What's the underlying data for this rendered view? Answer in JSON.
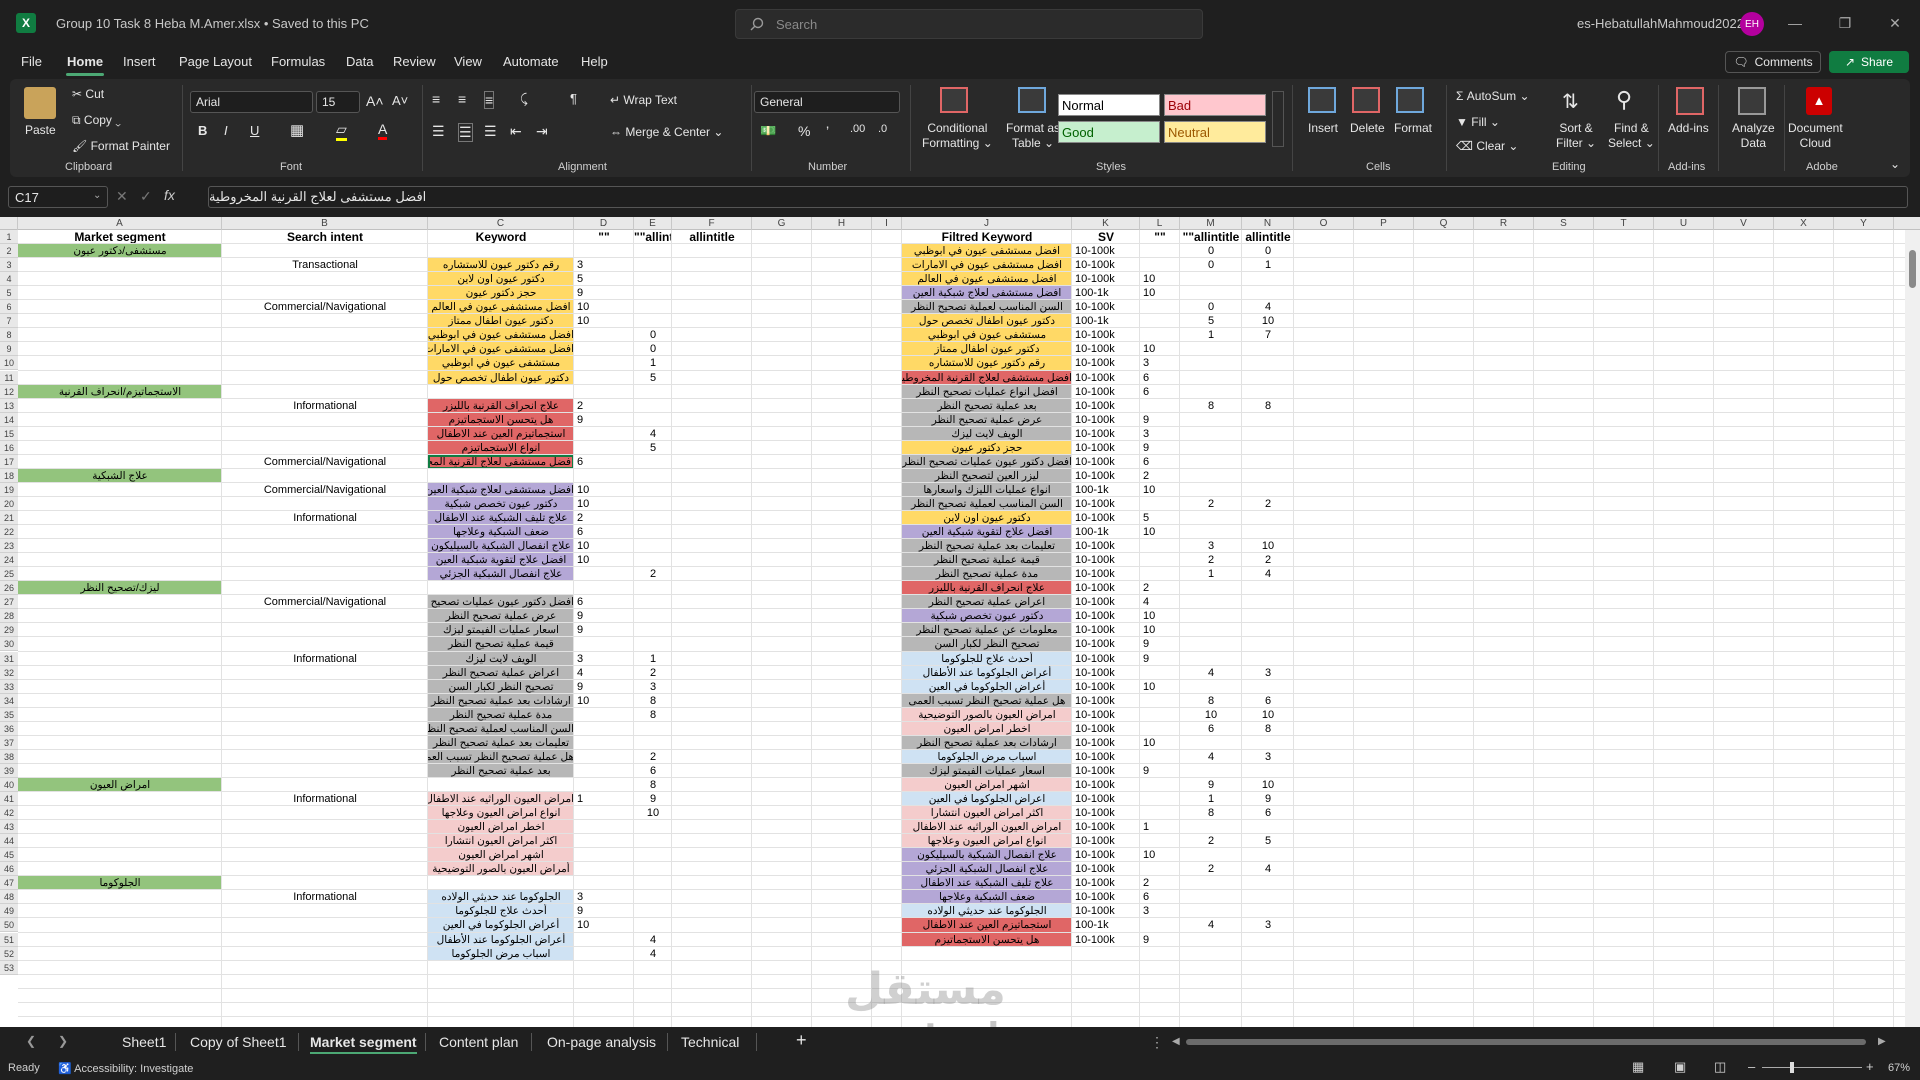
{
  "titlebar": {
    "file_title": "Group 10 Task 8 Heba M.Amer.xlsx  •  Saved to this PC",
    "search_placeholder": "Search",
    "account": "es-HebatullahMahmoud2022",
    "avatar_initials": "EH"
  },
  "menu": {
    "items": [
      "File",
      "Home",
      "Insert",
      "Page Layout",
      "Formulas",
      "Data",
      "Review",
      "View",
      "Automate",
      "Help"
    ],
    "comments": "Comments",
    "share": "Share"
  },
  "ribbon": {
    "clipboard": {
      "paste": "Paste",
      "cut": "Cut",
      "copy": "Copy",
      "format_painter": "Format Painter",
      "label": "Clipboard"
    },
    "font": {
      "name": "Arial",
      "size": "15",
      "label": "Font",
      "bold": "B",
      "italic": "I",
      "underline": "U"
    },
    "alignment": {
      "wrap": "Wrap Text",
      "merge": "Merge & Center",
      "label": "Alignment"
    },
    "number": {
      "format": "General",
      "label": "Number"
    },
    "styles": {
      "conditional": "Conditional",
      "formatting": "Formatting",
      "format_as": "Format as",
      "table": "Table",
      "normal": "Normal",
      "bad": "Bad",
      "good": "Good",
      "neutral": "Neutral",
      "label": "Styles"
    },
    "cells": {
      "insert": "Insert",
      "delete": "Delete",
      "format": "Format",
      "label": "Cells"
    },
    "editing": {
      "autosum": "AutoSum",
      "fill": "Fill",
      "clear": "Clear",
      "sort1": "Sort &",
      "sort2": "Filter",
      "find1": "Find &",
      "find2": "Select",
      "label": "Editing"
    },
    "addins": {
      "btn": "Add-ins",
      "label": "Add-ins"
    },
    "analyze": {
      "l1": "Analyze",
      "l2": "Data"
    },
    "adobe": {
      "l1": "Document",
      "l2": "Cloud",
      "label": "Adobe"
    }
  },
  "formula_bar": {
    "name_box": "C17",
    "content": "افضل مستشفى لعلاج القرنية المخروطية"
  },
  "columns": [
    "A",
    "B",
    "C",
    "D",
    "E",
    "F",
    "G",
    "H",
    "I",
    "J",
    "K",
    "L",
    "M",
    "N",
    "O",
    "P",
    "Q",
    "R",
    "S",
    "T",
    "U",
    "V",
    "X",
    "Y"
  ],
  "headers": {
    "A": "Market segment",
    "B": "Search intent",
    "C": "Keyword",
    "D": "\"\"",
    "E": "\"\"allintitle",
    "F": "allintitle",
    "J": "Filtred Keyword",
    "K": "SV",
    "L": "\"\"",
    "M": "\"\"allintitle",
    "N": "allintitle"
  },
  "segments": [
    {
      "row": 2,
      "text": "مستشفى/دكتور عيون"
    },
    {
      "row": 12,
      "text": "الاستجماتيزم/انحراف القرنية"
    },
    {
      "row": 18,
      "text": "علاج الشبكية"
    },
    {
      "row": 26,
      "text": "ليزك/تصحيح النظر"
    },
    {
      "row": 40,
      "text": "امراض العيون"
    },
    {
      "row": 47,
      "text": "الجلوكوما"
    }
  ],
  "intents": [
    {
      "row": 3,
      "text": "Transactional"
    },
    {
      "row": 6,
      "text": "Commercial/Navigational"
    },
    {
      "row": 13,
      "text": "Informational"
    },
    {
      "row": 17,
      "text": "Commercial/Navigational"
    },
    {
      "row": 19,
      "text": "Commercial/Navigational"
    },
    {
      "row": 21,
      "text": "Informational"
    },
    {
      "row": 27,
      "text": "Commercial/Navigational"
    },
    {
      "row": 31,
      "text": "Informational"
    },
    {
      "row": 41,
      "text": "Informational"
    },
    {
      "row": 48,
      "text": "Informational"
    }
  ],
  "keywords": [
    {
      "row": 3,
      "text": "رقم دكتور عيون للاستشاره",
      "color": "#ffd966"
    },
    {
      "row": 4,
      "text": "دكتور عيون اون لاين",
      "color": "#ffd966"
    },
    {
      "row": 5,
      "text": "حجز دكتور عيون",
      "color": "#ffd966"
    },
    {
      "row": 6,
      "text": "افضل مستشفى عيون في العالم",
      "color": "#ffd966"
    },
    {
      "row": 7,
      "text": "دكتور عيون اطفال ممتاز",
      "color": "#ffd966"
    },
    {
      "row": 8,
      "text": "افضل مستشفى عيون في ابوظبي",
      "color": "#ffd966"
    },
    {
      "row": 9,
      "text": "افضل مستشفى عيون في الامارات",
      "color": "#ffd966"
    },
    {
      "row": 10,
      "text": "مستشفى عيون في ابوظبي",
      "color": "#ffd966"
    },
    {
      "row": 11,
      "text": "دكتور عيون اطفال تخصص حول",
      "color": "#ffd966"
    },
    {
      "row": 13,
      "text": "علاج انحراف القرنية بالليزر",
      "color": "#e06666"
    },
    {
      "row": 14,
      "text": "هل يتحسن الاستجماتيزم",
      "color": "#e06666"
    },
    {
      "row": 15,
      "text": "استجماتيزم العين عند الاطفال",
      "color": "#e06666"
    },
    {
      "row": 16,
      "text": "انواع الاستجماتيزم",
      "color": "#e06666"
    },
    {
      "row": 17,
      "text": "افضل مستشفى لعلاج القرنية المخروطية",
      "color": "#e06666"
    },
    {
      "row": 19,
      "text": "افضل مستشفى لعلاج شبكية العين",
      "color": "#b4a7d6"
    },
    {
      "row": 20,
      "text": "دكتور عيون تخصص شبكية",
      "color": "#b4a7d6"
    },
    {
      "row": 21,
      "text": "علاج تليف الشبكية عند الاطفال",
      "color": "#b4a7d6"
    },
    {
      "row": 22,
      "text": "ضعف الشبكية وعلاجها",
      "color": "#b4a7d6"
    },
    {
      "row": 23,
      "text": "علاج انفصال الشبكية بالسيليكون",
      "color": "#b4a7d6"
    },
    {
      "row": 24,
      "text": "افضل علاج لتقوية شبكية العين",
      "color": "#b4a7d6"
    },
    {
      "row": 25,
      "text": "علاج انفصال الشبكية الجزئي",
      "color": "#b4a7d6"
    },
    {
      "row": 27,
      "text": "افضل دكتور عيون عمليات تصحيح النظر",
      "color": "#b7b7b7"
    },
    {
      "row": 28,
      "text": "عرض عملية تصحيح النظر",
      "color": "#b7b7b7"
    },
    {
      "row": 29,
      "text": "اسعار عمليات الفيمتو ليزك",
      "color": "#b7b7b7"
    },
    {
      "row": 30,
      "text": "قيمة عملية تصحيح النظر",
      "color": "#b7b7b7"
    },
    {
      "row": 31,
      "text": "الويف لايت ليزك",
      "color": "#b7b7b7"
    },
    {
      "row": 32,
      "text": "اعراض عملية تصحيح النظر",
      "color": "#b7b7b7"
    },
    {
      "row": 33,
      "text": "تصحيح النظر لكبار السن",
      "color": "#b7b7b7"
    },
    {
      "row": 34,
      "text": "ارشادات بعد عملية تصحيح النظر",
      "color": "#b7b7b7"
    },
    {
      "row": 35,
      "text": "مدة عملية تصحيح النظر",
      "color": "#b7b7b7"
    },
    {
      "row": 36,
      "text": "السن المناسب لعملية تصحيح النظر",
      "color": "#b7b7b7"
    },
    {
      "row": 37,
      "text": "تعليمات بعد عملية تصحيح النظر",
      "color": "#b7b7b7"
    },
    {
      "row": 38,
      "text": "هل عملية تصحيح النظر تسبب العمى",
      "color": "#b7b7b7"
    },
    {
      "row": 39,
      "text": "بعد عملية تصحيح النظر",
      "color": "#b7b7b7"
    },
    {
      "row": 41,
      "text": "امراض العيون الوراثيه عند الاطفال",
      "color": "#f4cccc"
    },
    {
      "row": 42,
      "text": "انواع امراض العيون وعلاجها",
      "color": "#f4cccc"
    },
    {
      "row": 43,
      "text": "اخطر امراض العيون",
      "color": "#f4cccc"
    },
    {
      "row": 44,
      "text": "اكثر امراض العيون انتشارا",
      "color": "#f4cccc"
    },
    {
      "row": 45,
      "text": "اشهر امراض العيون",
      "color": "#f4cccc"
    },
    {
      "row": 46,
      "text": "أمراض العيون بالصور التوضيحية",
      "color": "#f4cccc"
    },
    {
      "row": 48,
      "text": "الجلوكوما عند حديثي الولاده",
      "color": "#cfe2f3"
    },
    {
      "row": 49,
      "text": "أحدث علاج للجلوكوما",
      "color": "#cfe2f3"
    },
    {
      "row": 50,
      "text": "أعراض الجلوكوما في العين",
      "color": "#cfe2f3"
    },
    {
      "row": 51,
      "text": "أعراض الجلوكوما عند الأطفال",
      "color": "#cfe2f3"
    },
    {
      "row": 52,
      "text": "اسباب مرض الجلوكوما",
      "color": "#cfe2f3"
    }
  ],
  "d_values": [
    {
      "row": 3,
      "v": "3"
    },
    {
      "row": 4,
      "v": "5"
    },
    {
      "row": 5,
      "v": "9"
    },
    {
      "row": 6,
      "v": "10"
    },
    {
      "row": 7,
      "v": "10"
    },
    {
      "row": 13,
      "v": "2"
    },
    {
      "row": 14,
      "v": "9"
    },
    {
      "row": 17,
      "v": "6"
    },
    {
      "row": 19,
      "v": "10"
    },
    {
      "row": 20,
      "v": "10"
    },
    {
      "row": 21,
      "v": "2"
    },
    {
      "row": 22,
      "v": "6"
    },
    {
      "row": 23,
      "v": "10"
    },
    {
      "row": 24,
      "v": "10"
    },
    {
      "row": 27,
      "v": "6"
    },
    {
      "row": 28,
      "v": "9"
    },
    {
      "row": 29,
      "v": "9"
    },
    {
      "row": 31,
      "v": "3"
    },
    {
      "row": 32,
      "v": "4"
    },
    {
      "row": 33,
      "v": "9"
    },
    {
      "row": 34,
      "v": "10"
    },
    {
      "row": 41,
      "v": "1"
    },
    {
      "row": 48,
      "v": "3"
    },
    {
      "row": 49,
      "v": "9"
    },
    {
      "row": 50,
      "v": "10"
    }
  ],
  "e_values": [
    {
      "row": 8,
      "v": "0"
    },
    {
      "row": 9,
      "v": "0"
    },
    {
      "row": 10,
      "v": "1"
    },
    {
      "row": 11,
      "v": "5"
    },
    {
      "row": 15,
      "v": "4"
    },
    {
      "row": 16,
      "v": "5"
    },
    {
      "row": 25,
      "v": "2"
    },
    {
      "row": 31,
      "v": "1"
    },
    {
      "row": 32,
      "v": "2"
    },
    {
      "row": 33,
      "v": "3"
    },
    {
      "row": 34,
      "v": "8"
    },
    {
      "row": 35,
      "v": "8"
    },
    {
      "row": 38,
      "v": "2"
    },
    {
      "row": 39,
      "v": "6"
    },
    {
      "row": 40,
      "v": "8"
    },
    {
      "row": 41,
      "v": "9"
    },
    {
      "row": 42,
      "v": "10"
    },
    {
      "row": 51,
      "v": "4"
    },
    {
      "row": 52,
      "v": "4"
    }
  ],
  "filtered": [
    {
      "row": 2,
      "text": "افضل مستشفى عيون في ابوظبي",
      "color": "#ffd966",
      "sv": "10-100k",
      "l": "",
      "m": "0",
      "n": "0"
    },
    {
      "row": 3,
      "text": "افضل مستشفى عيون في الامارات",
      "color": "#ffd966",
      "sv": "10-100k",
      "l": "",
      "m": "0",
      "n": "1"
    },
    {
      "row": 4,
      "text": "افضل مستشفى عيون في العالم",
      "color": "#ffd966",
      "sv": "10-100k",
      "l": "10",
      "m": "",
      "n": ""
    },
    {
      "row": 5,
      "text": "افضل مستشفى لعلاج شبكية العين",
      "color": "#b4a7d6",
      "sv": "100-1k",
      "l": "10",
      "m": "",
      "n": ""
    },
    {
      "row": 6,
      "text": "السن المناسب لعملية تصحيح النظر",
      "color": "#b7b7b7",
      "sv": "10-100k",
      "l": "",
      "m": "0",
      "n": "4"
    },
    {
      "row": 7,
      "text": "دكتور عيون اطفال تخصص حول",
      "color": "#ffd966",
      "sv": "100-1k",
      "l": "",
      "m": "5",
      "n": "10"
    },
    {
      "row": 8,
      "text": "مستشفى عيون في ابوظبي",
      "color": "#ffd966",
      "sv": "10-100k",
      "l": "",
      "m": "1",
      "n": "7"
    },
    {
      "row": 9,
      "text": "دكتور عيون اطفال ممتاز",
      "color": "#ffd966",
      "sv": "10-100k",
      "l": "10",
      "m": "",
      "n": ""
    },
    {
      "row": 10,
      "text": "رقم دكتور عيون للاستشاره",
      "color": "#ffd966",
      "sv": "10-100k",
      "l": "3",
      "m": "",
      "n": ""
    },
    {
      "row": 11,
      "text": "افضل مستشفى لعلاج القرنية المخروطية",
      "color": "#e06666",
      "sv": "10-100k",
      "l": "6",
      "m": "",
      "n": ""
    },
    {
      "row": 12,
      "text": "افضل انواع عمليات تصحيح النظر",
      "color": "#b7b7b7",
      "sv": "10-100k",
      "l": "6",
      "m": "",
      "n": ""
    },
    {
      "row": 13,
      "text": "بعد عملية تصحيح النظر",
      "color": "#b7b7b7",
      "sv": "10-100k",
      "l": "",
      "m": "8",
      "n": "8"
    },
    {
      "row": 14,
      "text": "عرض عملية تصحيح النظر",
      "color": "#b7b7b7",
      "sv": "10-100k",
      "l": "9",
      "m": "",
      "n": ""
    },
    {
      "row": 15,
      "text": "الويف لايت ليزك",
      "color": "#b7b7b7",
      "sv": "10-100k",
      "l": "3",
      "m": "",
      "n": ""
    },
    {
      "row": 16,
      "text": "حجز دكتور عيون",
      "color": "#ffd966",
      "sv": "10-100k",
      "l": "9",
      "m": "",
      "n": ""
    },
    {
      "row": 17,
      "text": "افضل دكتور عيون عمليات تصحيح النظر",
      "color": "#b7b7b7",
      "sv": "10-100k",
      "l": "6",
      "m": "",
      "n": ""
    },
    {
      "row": 18,
      "text": "ليزر العين لتصحيح النظر",
      "color": "#b7b7b7",
      "sv": "10-100k",
      "l": "2",
      "m": "",
      "n": ""
    },
    {
      "row": 19,
      "text": "انواع عمليات الليزك واسعارها",
      "color": "#b7b7b7",
      "sv": "100-1k",
      "l": "10",
      "m": "",
      "n": ""
    },
    {
      "row": 20,
      "text": "السن المناسب لعملية تصحيح النظر",
      "color": "#b7b7b7",
      "sv": "10-100k",
      "l": "",
      "m": "2",
      "n": "2"
    },
    {
      "row": 21,
      "text": "دكتور عيون اون لاين",
      "color": "#ffd966",
      "sv": "10-100k",
      "l": "5",
      "m": "",
      "n": ""
    },
    {
      "row": 22,
      "text": "افضل علاج لتقوية شبكية العين",
      "color": "#b4a7d6",
      "sv": "100-1k",
      "l": "10",
      "m": "",
      "n": ""
    },
    {
      "row": 23,
      "text": "تعليمات بعد عملية تصحيح النظر",
      "color": "#b7b7b7",
      "sv": "10-100k",
      "l": "",
      "m": "3",
      "n": "10"
    },
    {
      "row": 24,
      "text": "قيمة عملية تصحيح النظر",
      "color": "#b7b7b7",
      "sv": "10-100k",
      "l": "",
      "m": "2",
      "n": "2"
    },
    {
      "row": 25,
      "text": "مدة عملية تصحيح النظر",
      "color": "#b7b7b7",
      "sv": "10-100k",
      "l": "",
      "m": "1",
      "n": "4"
    },
    {
      "row": 26,
      "text": "علاج انحراف القرنية بالليزر",
      "color": "#e06666",
      "sv": "10-100k",
      "l": "2",
      "m": "",
      "n": ""
    },
    {
      "row": 27,
      "text": "اعراض عملية تصحيح النظر",
      "color": "#b7b7b7",
      "sv": "10-100k",
      "l": "4",
      "m": "",
      "n": ""
    },
    {
      "row": 28,
      "text": "دكتور عيون تخصص شبكية",
      "color": "#b4a7d6",
      "sv": "10-100k",
      "l": "10",
      "m": "",
      "n": ""
    },
    {
      "row": 29,
      "text": "معلومات عن عملية تصحيح النظر",
      "color": "#b7b7b7",
      "sv": "10-100k",
      "l": "10",
      "m": "",
      "n": ""
    },
    {
      "row": 30,
      "text": "تصحيح النظر لكبار السن",
      "color": "#b7b7b7",
      "sv": "10-100k",
      "l": "9",
      "m": "",
      "n": ""
    },
    {
      "row": 31,
      "text": "أحدث علاج للجلوكوما",
      "color": "#cfe2f3",
      "sv": "10-100k",
      "l": "9",
      "m": "",
      "n": ""
    },
    {
      "row": 32,
      "text": "أعراض الجلوكوما عند الأطفال",
      "color": "#cfe2f3",
      "sv": "10-100k",
      "l": "",
      "m": "4",
      "n": "3"
    },
    {
      "row": 33,
      "text": "أعراض الجلوكوما في العين",
      "color": "#cfe2f3",
      "sv": "10-100k",
      "l": "10",
      "m": "",
      "n": ""
    },
    {
      "row": 34,
      "text": "هل عملية تصحيح النظر تسبب العمى",
      "color": "#b7b7b7",
      "sv": "10-100k",
      "l": "",
      "m": "8",
      "n": "6"
    },
    {
      "row": 35,
      "text": "امراض العيون بالصور التوضيحية",
      "color": "#f4cccc",
      "sv": "10-100k",
      "l": "",
      "m": "10",
      "n": "10"
    },
    {
      "row": 36,
      "text": "اخطر امراض العيون",
      "color": "#f4cccc",
      "sv": "10-100k",
      "l": "",
      "m": "6",
      "n": "8"
    },
    {
      "row": 37,
      "text": "ارشادات بعد عملية تصحيح النظر",
      "color": "#b7b7b7",
      "sv": "10-100k",
      "l": "10",
      "m": "",
      "n": ""
    },
    {
      "row": 38,
      "text": "اسباب مرض الجلوكوما",
      "color": "#cfe2f3",
      "sv": "10-100k",
      "l": "",
      "m": "4",
      "n": "3"
    },
    {
      "row": 39,
      "text": "اسعار عمليات الفيمتو ليزك",
      "color": "#b7b7b7",
      "sv": "10-100k",
      "l": "9",
      "m": "",
      "n": ""
    },
    {
      "row": 40,
      "text": "اشهر امراض العيون",
      "color": "#f4cccc",
      "sv": "10-100k",
      "l": "",
      "m": "9",
      "n": "10"
    },
    {
      "row": 41,
      "text": "اعراض الجلوكوما في العين",
      "color": "#cfe2f3",
      "sv": "10-100k",
      "l": "",
      "m": "1",
      "n": "9"
    },
    {
      "row": 42,
      "text": "اكثر امراض العيون انتشارا",
      "color": "#f4cccc",
      "sv": "10-100k",
      "l": "",
      "m": "8",
      "n": "6"
    },
    {
      "row": 43,
      "text": "امراض العيون الوراثيه عند الاطفال",
      "color": "#f4cccc",
      "sv": "10-100k",
      "l": "1",
      "m": "",
      "n": ""
    },
    {
      "row": 44,
      "text": "انواع امراض العيون وعلاجها",
      "color": "#f4cccc",
      "sv": "10-100k",
      "l": "",
      "m": "2",
      "n": "5"
    },
    {
      "row": 45,
      "text": "علاج انفصال الشبكية بالسيليكون",
      "color": "#b4a7d6",
      "sv": "10-100k",
      "l": "10",
      "m": "",
      "n": ""
    },
    {
      "row": 46,
      "text": "علاج انفصال الشبكية الجزئي",
      "color": "#b4a7d6",
      "sv": "10-100k",
      "l": "",
      "m": "2",
      "n": "4"
    },
    {
      "row": 47,
      "text": "علاج تليف الشبكية عند الاطفال",
      "color": "#b4a7d6",
      "sv": "10-100k",
      "l": "2",
      "m": "",
      "n": ""
    },
    {
      "row": 48,
      "text": "ضعف الشبكية وعلاجها",
      "color": "#b4a7d6",
      "sv": "10-100k",
      "l": "6",
      "m": "",
      "n": ""
    },
    {
      "row": 49,
      "text": "الجلوكوما عند حديثي الولاده",
      "color": "#cfe2f3",
      "sv": "10-100k",
      "l": "3",
      "m": "",
      "n": ""
    },
    {
      "row": 50,
      "text": "استجماتيزم العين عند الاطفال",
      "color": "#e06666",
      "sv": "100-1k",
      "l": "",
      "m": "4",
      "n": "3"
    },
    {
      "row": 51,
      "text": "هل يتحسن الاستجماتيزم",
      "color": "#e06666",
      "sv": "10-100k",
      "l": "9",
      "m": "",
      "n": ""
    }
  ],
  "sheets": [
    "Sheet1",
    "Copy of Sheet1",
    "Market segment",
    "Content plan",
    "On-page analysis",
    "Technical"
  ],
  "status": {
    "ready": "Ready",
    "accessibility": "Accessibility: Investigate",
    "zoom": "67%"
  },
  "watermark": {
    "arabic": "مستقل",
    "latin": "mostaql.com"
  },
  "colors": {
    "segment_green": "#93c47d",
    "yellow": "#ffd966",
    "red": "#e06666",
    "purple": "#b4a7d6",
    "gray": "#b7b7b7",
    "pink": "#f4cccc",
    "blue": "#cfe2f3",
    "accent": "#107c41"
  }
}
